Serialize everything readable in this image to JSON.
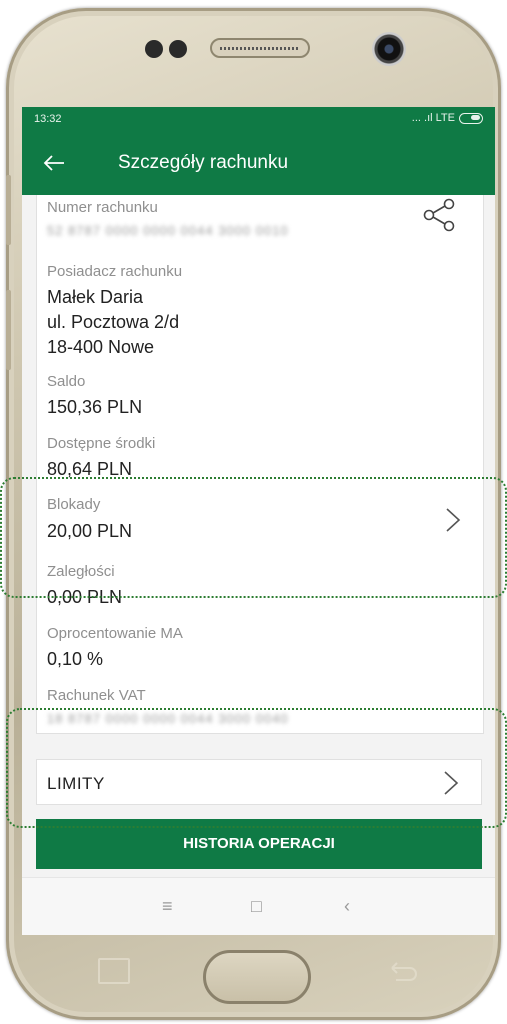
{
  "status_bar": {
    "time": "13:32",
    "network": "... .ıl LTE"
  },
  "app_bar": {
    "title": "Szczegóły rachunku"
  },
  "details": {
    "account_number_label": "Numer rachunku",
    "account_number_value": "52 8787 0000 0000 0044 3000 0010",
    "holder_label": "Posiadacz rachunku",
    "holder_name": "Małek Daria",
    "holder_street": "ul. Pocztowa 2/d",
    "holder_city": "18-400 Nowe",
    "balance_label": "Saldo",
    "balance_value": "150,36 PLN",
    "available_label": "Dostępne środki",
    "available_value": "80,64 PLN",
    "blocks_label": "Blokady",
    "blocks_value": "20,00 PLN",
    "arrears_label": "Zaległości",
    "arrears_value": "0,00 PLN",
    "interest_label": "Oprocentowanie MA",
    "interest_value": "0,10 %",
    "vat_label": "Rachunek VAT",
    "vat_value": "18 8787 0000 0000 0044 3000 0040"
  },
  "limits": {
    "label": "LIMITY"
  },
  "history_button": {
    "label": "HISTORIA OPERACJI"
  },
  "nav": {
    "menu": "≡",
    "home": "□",
    "back": "‹"
  },
  "colors": {
    "brand_green": "#0f7a45",
    "highlight_green": "#2d7d32"
  },
  "icons": [
    "back-arrow-icon",
    "share-icon",
    "chevron-right-icon",
    "battery-icon"
  ]
}
